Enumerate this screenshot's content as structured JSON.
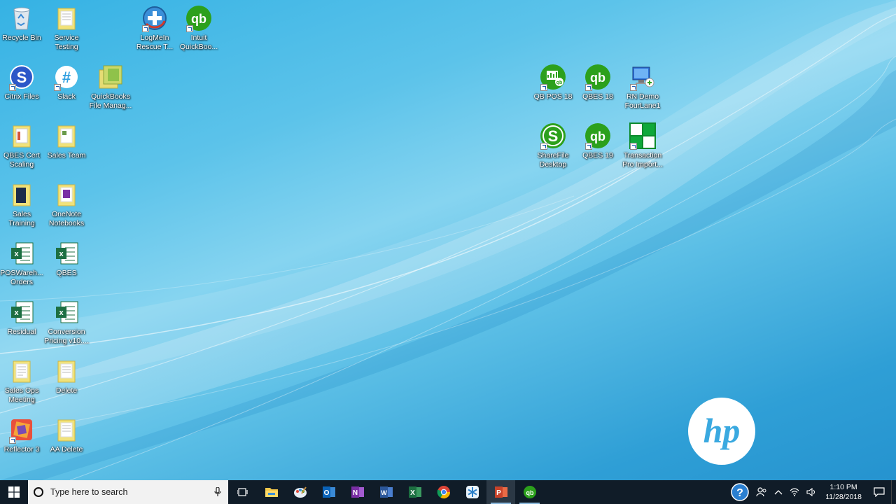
{
  "desktop": {
    "icons": [
      {
        "label": "Recycle Bin",
        "icon": "recycle-bin-icon"
      },
      {
        "label": "Service Testing",
        "icon": "folder-icon"
      },
      {
        "label": "LogMeIn Rescue T...",
        "icon": "logmein-rescue-icon"
      },
      {
        "label": "Intuit QuickBoo...",
        "icon": "quickbooks-icon"
      },
      {
        "label": "Citrix Files",
        "icon": "citrix-files-icon"
      },
      {
        "label": "Slack",
        "icon": "slack-icon"
      },
      {
        "label": "QuickBooks File Manag...",
        "icon": "quickbooks-file-manager-icon"
      },
      {
        "label": "QBES Cert Scaling",
        "icon": "folder-icon"
      },
      {
        "label": "Sales Team",
        "icon": "folder-icon"
      },
      {
        "label": "Sales Training",
        "icon": "folder-icon"
      },
      {
        "label": "OneNote Notebooks",
        "icon": "onenote-folder-icon"
      },
      {
        "label": "POSWareh... Orders",
        "icon": "excel-file-icon"
      },
      {
        "label": "QBES",
        "icon": "excel-file-icon"
      },
      {
        "label": "Residual",
        "icon": "excel-file-icon"
      },
      {
        "label": "Conversion Pricing v10....",
        "icon": "excel-file-icon"
      },
      {
        "label": "Sales Ops Meeting",
        "icon": "folder-icon"
      },
      {
        "label": "Delete",
        "icon": "folder-icon"
      },
      {
        "label": "Reflector 3",
        "icon": "reflector-icon"
      },
      {
        "label": "AA Delete",
        "icon": "folder-icon"
      },
      {
        "label": "QB POS 18",
        "icon": "qb-pos-icon"
      },
      {
        "label": "QBES 18",
        "icon": "quickbooks-icon"
      },
      {
        "label": "RN Demo FourLane1",
        "icon": "remote-desktop-icon"
      },
      {
        "label": "ShareFile Desktop",
        "icon": "sharefile-icon"
      },
      {
        "label": "QBES 19",
        "icon": "quickbooks-icon"
      },
      {
        "label": "Transaction Pro Import...",
        "icon": "transaction-pro-icon"
      }
    ],
    "brand_logo_text": "hp"
  },
  "taskbar": {
    "search_placeholder": "Type here to search",
    "apps": [
      {
        "name": "task-view",
        "icon": "task-view-icon"
      },
      {
        "name": "file-explorer",
        "icon": "folder-icon"
      },
      {
        "name": "paint",
        "icon": "paint-icon"
      },
      {
        "name": "outlook",
        "icon": "outlook-icon"
      },
      {
        "name": "onenote",
        "icon": "onenote-icon"
      },
      {
        "name": "word",
        "icon": "word-icon"
      },
      {
        "name": "excel",
        "icon": "excel-icon"
      },
      {
        "name": "chrome",
        "icon": "chrome-icon"
      },
      {
        "name": "snowflake-app",
        "icon": "snowflake-icon"
      },
      {
        "name": "powerpoint",
        "icon": "powerpoint-icon"
      },
      {
        "name": "quickbooks",
        "icon": "quickbooks-icon"
      }
    ],
    "clock_time": "1:10 PM",
    "clock_date": "11/28/2018"
  },
  "colors": {
    "desktop_blue": "#35b2e4",
    "taskbar": "#101c28",
    "quickbooks_green": "#2ca01c",
    "excel_green": "#1d6f42"
  }
}
